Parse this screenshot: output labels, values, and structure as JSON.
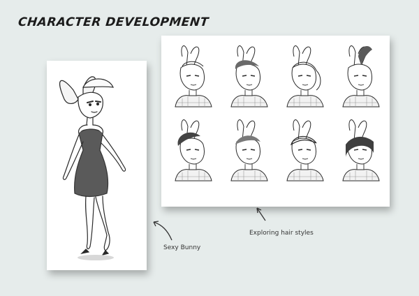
{
  "page": {
    "title": "CHARACTER DEVELOPMENT",
    "captions": {
      "full_body": "Sexy Bunny",
      "hair_styles": "Exploring hair styles"
    }
  },
  "colors": {
    "background": "#e6eceb",
    "card": "#ffffff",
    "ink": "#2a2a2a",
    "dress": "#555555"
  },
  "illustrations": {
    "full_body_sketch": "bunny-girl-full-body-sketch",
    "hair_variations_count": 8
  }
}
